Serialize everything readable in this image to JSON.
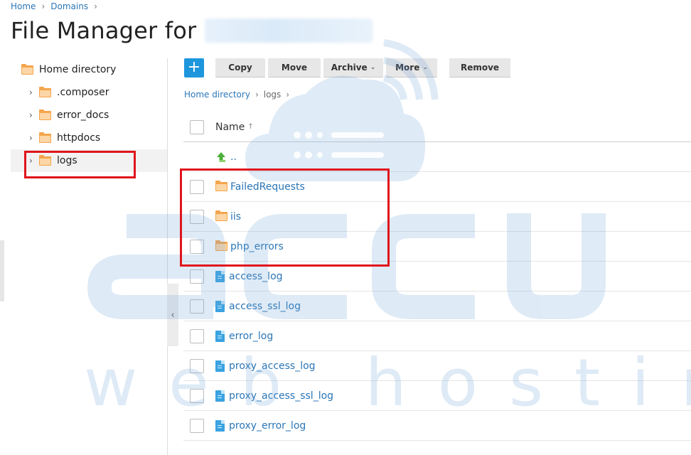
{
  "breadcrumb": {
    "items": [
      "Home",
      "Domains"
    ]
  },
  "page": {
    "title": "File Manager for"
  },
  "tree": {
    "root": "Home directory",
    "children": [
      ".composer",
      "error_docs",
      "httpdocs",
      "logs"
    ]
  },
  "toolbar": {
    "add_label": "+",
    "copy": "Copy",
    "move": "Move",
    "archive": "Archive",
    "more": "More",
    "remove": "Remove"
  },
  "path": {
    "root": "Home directory",
    "current": "logs"
  },
  "table": {
    "name_header": "Name",
    "parent_label": "..",
    "folders": [
      "FailedRequests",
      "iis",
      "php_errors"
    ],
    "files": [
      "access_log",
      "access_ssl_log",
      "error_log",
      "proxy_access_log",
      "proxy_access_ssl_log",
      "proxy_error_log"
    ]
  },
  "watermark": {
    "top": "accu",
    "bottom": "web hosting"
  },
  "colors": {
    "link": "#2b76b6",
    "accent": "#1e96dd",
    "folder": "#f5a54c",
    "highlight": "#e0141c"
  }
}
